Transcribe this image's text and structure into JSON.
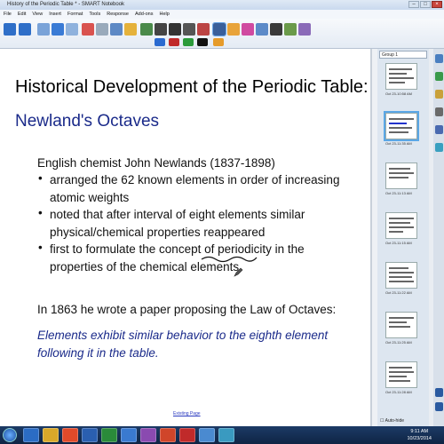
{
  "window": {
    "title": "History of the Periodic Table * - SMART Notebook"
  },
  "menu": [
    "File",
    "Edit",
    "View",
    "Insert",
    "Format",
    "Tools",
    "Response",
    "Add-ons",
    "Help"
  ],
  "slide": {
    "title": "Historical Development of the Periodic Table:",
    "subtitle": "Newland's Octaves",
    "intro": "English chemist John Newlands (1837-1898)",
    "bullets": [
      {
        "line1": "arranged the 62 known elements in order of increasing",
        "line2": "atomic weights"
      },
      {
        "line1": "noted that after interval of eight elements similar",
        "line2": "physical/chemical properties reappeared"
      },
      {
        "line1": "first to formulate the concept of periodicity in the",
        "line2": "properties of the chemical elements"
      }
    ],
    "law_text": "In 1863 he wrote a paper proposing the Law of Octaves:",
    "quote_line1": "Elements exhibit similar behavior to the eighth element",
    "quote_line2": "following it in the table.",
    "link": "Existing Page"
  },
  "sorter": {
    "group": "Group 1",
    "dates": [
      "Oct 23-10:58 AM",
      "Oct 23-11:35 AM",
      "Oct 23-11:13 AM",
      "Oct 23-11:15 AM",
      "Oct 23-11:22 AM",
      "Oct 23-11:25 AM",
      "Oct 23-11:28 AM"
    ],
    "autohide": "Auto-hide"
  },
  "taskbar": {
    "time": "9:11 AM",
    "date": "10/23/2014"
  }
}
